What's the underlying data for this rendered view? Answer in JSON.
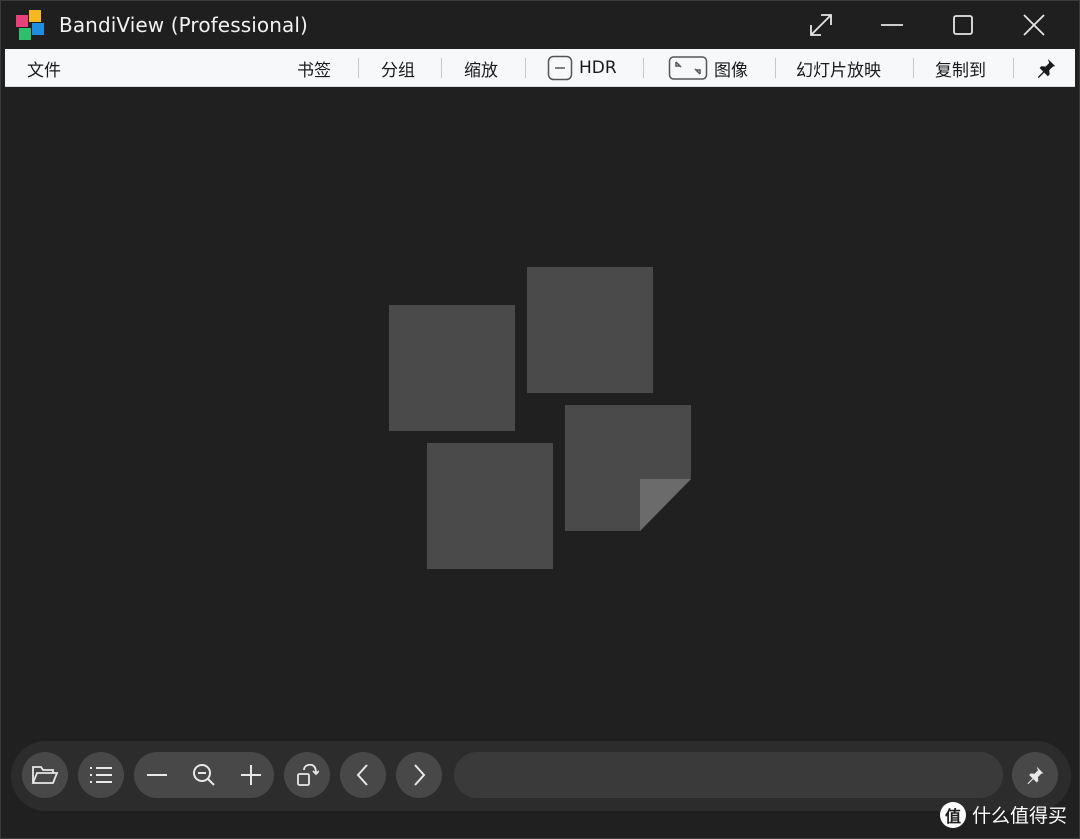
{
  "window": {
    "title": "BandiView (Professional)"
  },
  "menu": {
    "file": "文件",
    "bookmark": "书签",
    "group": "分组",
    "zoom": "缩放",
    "hdr": "HDR",
    "image": "图像",
    "slideshow": "幻灯片放映",
    "copy_to": "复制到"
  },
  "icons": {
    "logo": "app-logo-icon",
    "fullscreen": "expand-diagonal-icon",
    "minimize": "minimize-icon",
    "maximize": "maximize-icon",
    "close": "close-icon",
    "pin": "pin-icon",
    "open": "folder-open-icon",
    "list": "list-icon",
    "zoom_out_line": "minus-icon",
    "zoom_fit": "zoom-out-magnifier-icon",
    "zoom_in": "plus-icon",
    "rotate": "rotate-icon",
    "prev": "chevron-left-icon",
    "next": "chevron-right-icon"
  },
  "colors": {
    "background": "#202020",
    "titlebar": "#1f1f1f",
    "menubar": "#f7f8fa",
    "placeholder": "#4a4a4a",
    "toolbar": "#2c2c2c",
    "button": "#484848"
  },
  "watermark": {
    "badge": "值",
    "text": "什么值得买"
  }
}
